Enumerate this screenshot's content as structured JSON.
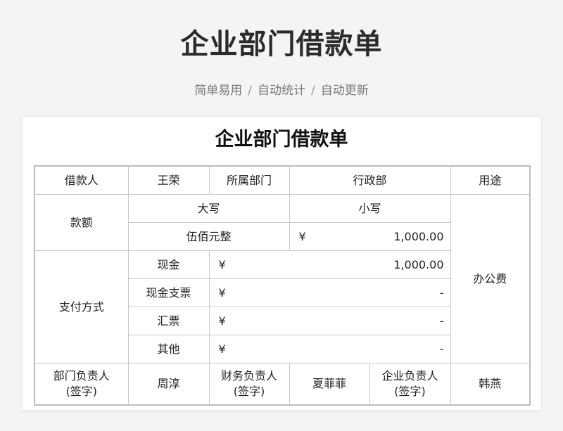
{
  "page": {
    "title": "企业部门借款单",
    "subtitle": [
      "简单易用",
      "自动统计",
      "自动更新"
    ],
    "separator": "/"
  },
  "doc": {
    "title": "企业部门借款单",
    "row1": {
      "borrower_label": "借款人",
      "borrower_value": "王荣",
      "dept_label": "所属部门",
      "dept_value": "行政部",
      "purpose_label": "用途"
    },
    "amount": {
      "label": "款额",
      "upper_label": "大写",
      "lower_label": "小写",
      "upper_value": "伍佰元整",
      "currency": "¥",
      "lower_value": "1,000.00"
    },
    "purpose_value": "办公费",
    "payment": {
      "label": "支付方式",
      "methods": [
        {
          "name": "现金",
          "currency": "¥",
          "amount": "1,000.00"
        },
        {
          "name": "现金支票",
          "currency": "¥",
          "amount": "-"
        },
        {
          "name": "汇票",
          "currency": "¥",
          "amount": "-"
        },
        {
          "name": "其他",
          "currency": "¥",
          "amount": "-"
        }
      ]
    },
    "signatures": {
      "dept_head_label": "部门负责人",
      "dept_head_value": "周淳",
      "finance_head_label": "财务负责人",
      "finance_head_value": "夏菲菲",
      "company_head_label": "企业负责人",
      "company_head_value": "韩燕",
      "sign_note": "(签字)"
    }
  }
}
